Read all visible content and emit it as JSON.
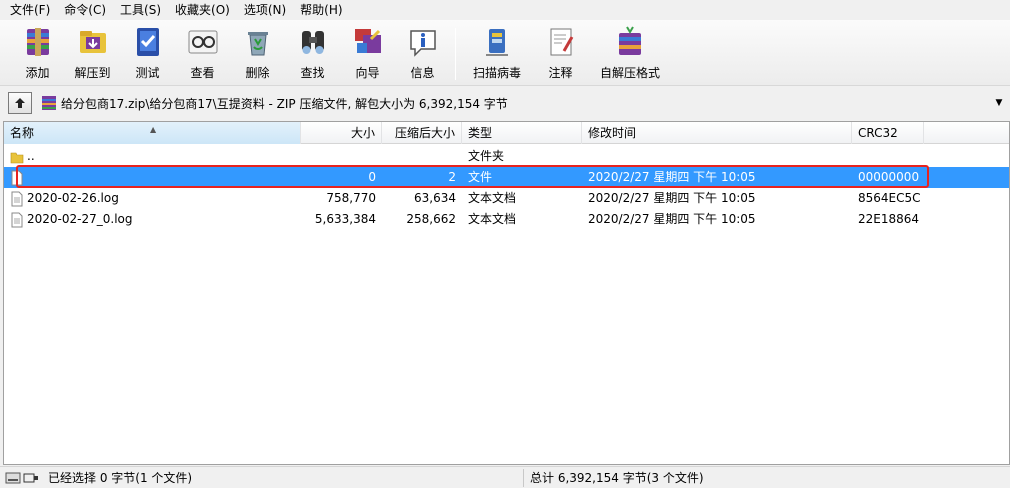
{
  "menu": [
    "文件(F)",
    "命令(C)",
    "工具(S)",
    "收藏夹(O)",
    "选项(N)",
    "帮助(H)"
  ],
  "toolbar": [
    {
      "label": "添加",
      "icon": "add-archive-icon"
    },
    {
      "label": "解压到",
      "icon": "extract-to-icon"
    },
    {
      "label": "测试",
      "icon": "test-icon"
    },
    {
      "label": "查看",
      "icon": "view-icon"
    },
    {
      "label": "删除",
      "icon": "delete-icon"
    },
    {
      "label": "查找",
      "icon": "find-icon"
    },
    {
      "label": "向导",
      "icon": "wizard-icon"
    },
    {
      "label": "信息",
      "icon": "info-icon"
    },
    {
      "label": "扫描病毒",
      "icon": "virus-scan-icon"
    },
    {
      "label": "注释",
      "icon": "comment-icon"
    },
    {
      "label": "自解压格式",
      "icon": "sfx-icon"
    }
  ],
  "address": {
    "path": "给分包商17.zip\\给分包商17\\互提资料 - ZIP 压缩文件, 解包大小为 6,392,154 字节"
  },
  "columns": {
    "name": "名称",
    "size": "大小",
    "packed": "压缩后大小",
    "type": "类型",
    "modified": "修改时间",
    "crc": "CRC32"
  },
  "files": [
    {
      "name": "..",
      "size": "",
      "packed": "",
      "type": "文件夹",
      "modified": "",
      "crc": "",
      "icon": "folder-icon",
      "selected": false
    },
    {
      "name": "",
      "size": "0",
      "packed": "2",
      "type": "文件",
      "modified": "2020/2/27 星期四 下午 10:05",
      "crc": "00000000",
      "icon": "file-icon",
      "selected": true
    },
    {
      "name": "2020-02-26.log",
      "size": "758,770",
      "packed": "63,634",
      "type": "文本文档",
      "modified": "2020/2/27 星期四 下午 10:05",
      "crc": "8564EC5C",
      "icon": "text-file-icon",
      "selected": false
    },
    {
      "name": "2020-02-27_0.log",
      "size": "5,633,384",
      "packed": "258,662",
      "type": "文本文档",
      "modified": "2020/2/27 星期四 下午 10:05",
      "crc": "22E18864",
      "icon": "text-file-icon",
      "selected": false
    }
  ],
  "status": {
    "left": "已经选择 0 字节(1 个文件)",
    "right": "总计 6,392,154 字节(3 个文件)"
  },
  "colors": {
    "selection": "#3399ff",
    "highlight_box": "#e8231f"
  }
}
